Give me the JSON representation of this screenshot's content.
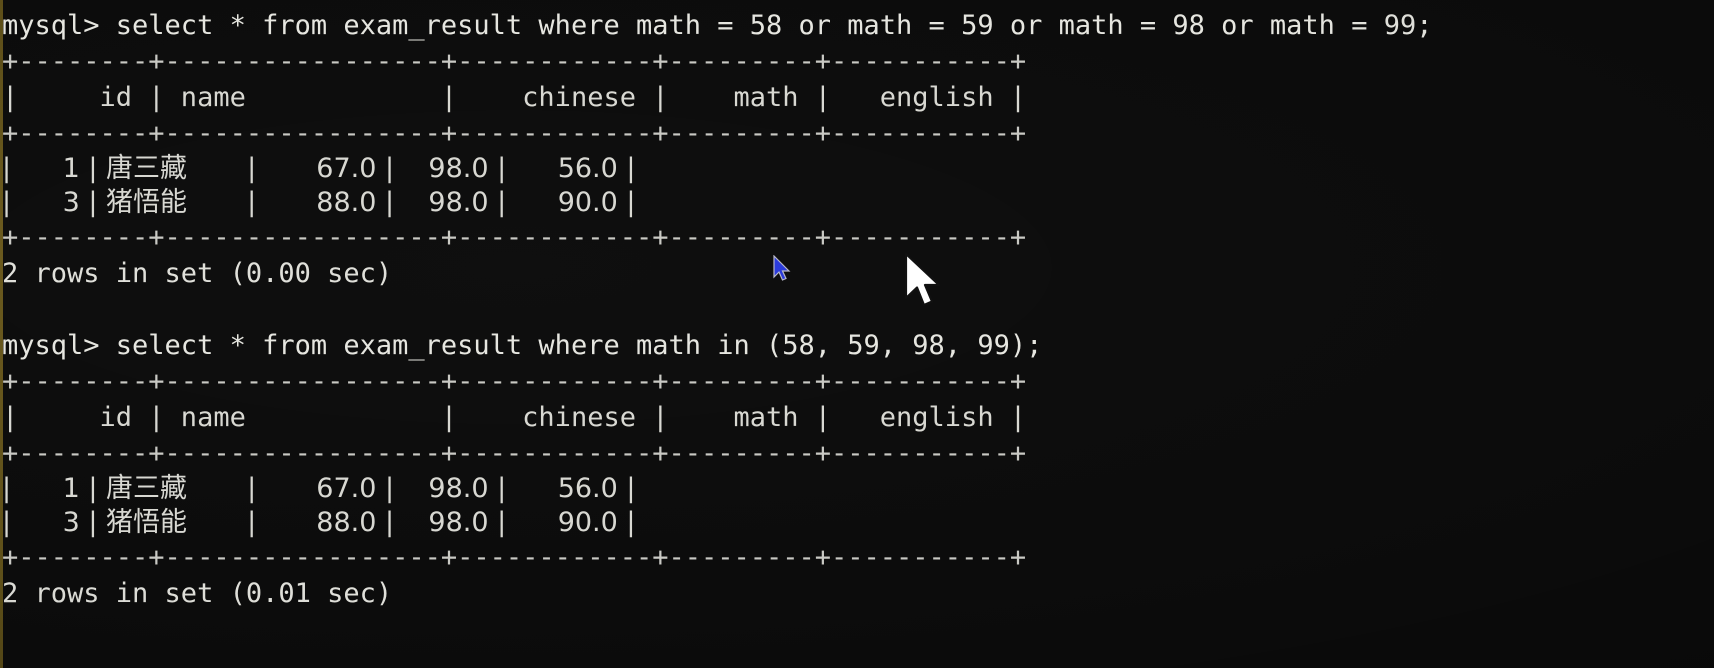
{
  "terminal": {
    "prompt": "mysql>",
    "background_color": "#0c0c0c",
    "foreground_color": "#d8d8d2",
    "cursor_blue_color": "#2b3bdb",
    "cursor_white_color": "#ffffff"
  },
  "session": {
    "blocks": [
      {
        "command": "mysql> select * from exam_result where math = 58 or math = 59 or math = 98 or math = 99;",
        "table": {
          "top_rule": "+--------+-----------------+------------+---------+-----------+",
          "header_row": "|     id | name            |    chinese |    math |   english |",
          "header_rule": "+--------+-----------------+------------+---------+-----------+",
          "rows": [
            "|      1 | 唐三藏       |       67.0 |    98.0 |      56.0 |",
            "|      3 | 猪悟能       |       88.0 |    98.0 |      90.0 |"
          ],
          "bottom_rule": "+--------+-----------------+------------+---------+-----------+"
        },
        "status": "2 rows in set (0.00 sec)"
      },
      {
        "command": "mysql> select * from exam_result where math in (58, 59, 98, 99);",
        "table": {
          "top_rule": "+--------+-----------------+------------+---------+-----------+",
          "header_row": "|     id | name            |    chinese |    math |   english |",
          "header_rule": "+--------+-----------------+------------+---------+-----------+",
          "rows": [
            "|      1 | 唐三藏       |       67.0 |    98.0 |      56.0 |",
            "|      3 | 猪悟能       |       88.0 |    98.0 |      90.0 |"
          ],
          "bottom_rule": "+--------+-----------------+------------+---------+-----------+"
        },
        "status": "2 rows in set (0.01 sec)"
      }
    ],
    "table_columns": [
      "id",
      "name",
      "chinese",
      "math",
      "english"
    ],
    "result_data": {
      "columns": [
        "id",
        "name",
        "chinese",
        "math",
        "english"
      ],
      "rows": [
        [
          "1",
          "唐三藏",
          "67.0",
          "98.0",
          "56.0"
        ],
        [
          "3",
          "猪悟能",
          "88.0",
          "98.0",
          "90.0"
        ]
      ]
    }
  }
}
